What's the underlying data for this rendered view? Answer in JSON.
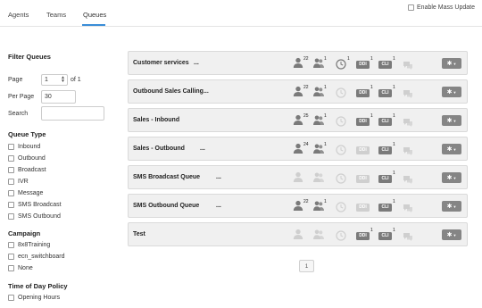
{
  "tabs": [
    {
      "label": "Agents",
      "active": false
    },
    {
      "label": "Teams",
      "active": false
    },
    {
      "label": "Queues",
      "active": true
    }
  ],
  "mass_update": {
    "label": "Enable Mass Update",
    "checked": false
  },
  "filter": {
    "title": "Filter Queues",
    "page_label": "Page",
    "page_value": "1",
    "page_of": "of 1",
    "per_page_label": "Per Page",
    "per_page_value": "30",
    "search_label": "Search",
    "search_value": ""
  },
  "queue_type": {
    "title": "Queue Type",
    "options": [
      "Inbound",
      "Outbound",
      "Broadcast",
      "IVR",
      "Message",
      "SMS Broadcast",
      "SMS Outbound"
    ]
  },
  "campaign": {
    "title": "Campaign",
    "options": [
      "8x8Training",
      "ecn_switchboard",
      "None"
    ]
  },
  "time_of_day": {
    "title": "Time of Day Policy",
    "options": [
      "Opening Hours"
    ]
  },
  "queues": [
    {
      "name": "Customer services",
      "more": "...",
      "agents": "22",
      "groups": "1",
      "time": "1",
      "ddi": "DDI",
      "ddi_count": "1",
      "cli": "CLI",
      "cli_count": "1",
      "agents_on": true,
      "time_on": true,
      "ddi_on": true,
      "cli_on": true
    },
    {
      "name": "Outbound Sales Calling...",
      "more": "",
      "agents": "22",
      "groups": "1",
      "time": "",
      "ddi": "DDI",
      "ddi_count": "1",
      "cli": "CLI",
      "cli_count": "1",
      "agents_on": true,
      "time_on": false,
      "ddi_on": true,
      "cli_on": true
    },
    {
      "name": "Sales - Inbound",
      "more": "",
      "agents": "25",
      "groups": "1",
      "time": "",
      "ddi": "DDI",
      "ddi_count": "1",
      "cli": "CLI",
      "cli_count": "1",
      "agents_on": true,
      "time_on": false,
      "ddi_on": true,
      "cli_on": true
    },
    {
      "name": "Sales - Outbound",
      "more": "...",
      "agents": "24",
      "groups": "1",
      "time": "",
      "ddi": "DDI",
      "ddi_count": "",
      "cli": "CLI",
      "cli_count": "1",
      "agents_on": true,
      "time_on": false,
      "ddi_on": false,
      "cli_on": true
    },
    {
      "name": "SMS Broadcast Queue",
      "more": "...",
      "agents": "",
      "groups": "",
      "time": "",
      "ddi": "DDI",
      "ddi_count": "",
      "cli": "CLI",
      "cli_count": "1",
      "agents_on": false,
      "time_on": false,
      "ddi_on": false,
      "cli_on": true
    },
    {
      "name": "SMS Outbound Queue",
      "more": "...",
      "agents": "22",
      "groups": "1",
      "time": "",
      "ddi": "DDI",
      "ddi_count": "",
      "cli": "CLI",
      "cli_count": "1",
      "agents_on": true,
      "time_on": false,
      "ddi_on": false,
      "cli_on": true
    },
    {
      "name": "Test",
      "more": "",
      "agents": "",
      "groups": "",
      "time": "",
      "ddi": "DDI",
      "ddi_count": "1",
      "cli": "CLI",
      "cli_count": "1",
      "agents_on": false,
      "time_on": false,
      "ddi_on": true,
      "cli_on": true
    }
  ],
  "pagination": {
    "current": "1"
  },
  "colors": {
    "accent": "#3a8ed8",
    "icon_on": "#7a7a7a",
    "icon_off": "#cfcfcf",
    "row_bg": "#f0f0f0"
  },
  "icons": [
    "agent-icon",
    "group-icon",
    "clock-icon",
    "chat-icon",
    "gear-icon"
  ]
}
